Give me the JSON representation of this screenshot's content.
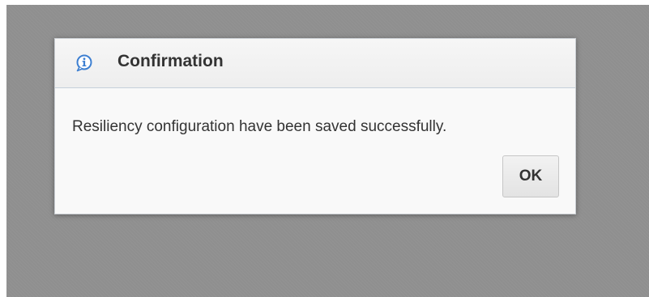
{
  "dialog": {
    "title": "Confirmation",
    "icon": "info-icon",
    "message": "Resiliency configuration have been saved successfully.",
    "ok_label": "OK"
  },
  "colors": {
    "overlay": "#8f8f8f",
    "dialog_background": "#f9f9f9",
    "header_background": "#f2f2f2",
    "icon_accent": "#3d7fd1",
    "text": "#333333"
  }
}
